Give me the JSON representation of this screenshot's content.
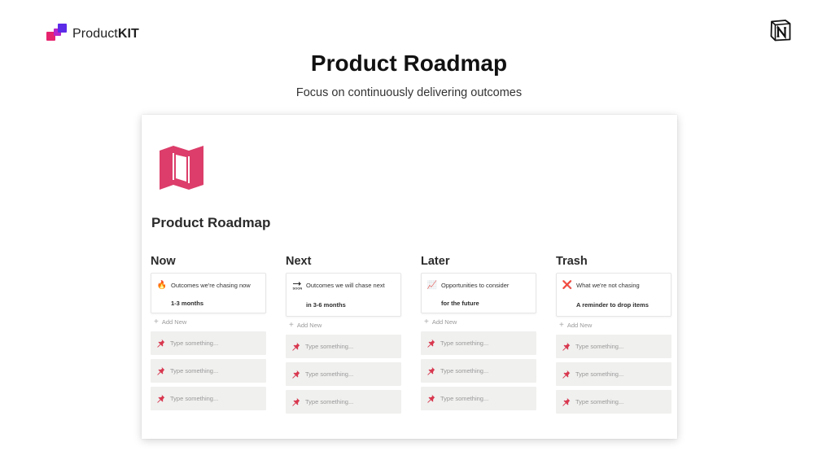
{
  "brand": {
    "name_plain": "Product",
    "name_bold": "KIT",
    "logo_icon": "productkit-logo-icon"
  },
  "header": {
    "title": "Product Roadmap",
    "subtitle": "Focus on continuously delivering outcomes",
    "notion_icon": "notion-logo-icon"
  },
  "board": {
    "page_icon": "map-icon",
    "title": "Product Roadmap",
    "accent_color": "#e0436b",
    "add_new_label": "Add New",
    "columns": [
      {
        "title": "Now",
        "cover_emoji": "🔥",
        "cover_icon": "fire-icon",
        "cover_text": "Outcomes we're chasing now",
        "cover_sub": "1-3 months",
        "items": [
          "Type something...",
          "Type something...",
          "Type something..."
        ]
      },
      {
        "title": "Next",
        "cover_emoji": "🔜",
        "cover_icon": "soon-arrow-icon",
        "cover_text": "Outcomes we will chase next",
        "cover_sub": "in 3-6 months",
        "items": [
          "Type something...",
          "Type something...",
          "Type something..."
        ]
      },
      {
        "title": "Later",
        "cover_emoji": "📈",
        "cover_icon": "chart-icon",
        "cover_text": "Opportunities to consider",
        "cover_sub": "for the future",
        "items": [
          "Type something...",
          "Type something...",
          "Type something..."
        ]
      },
      {
        "title": "Trash",
        "cover_emoji": "❌",
        "cover_icon": "cross-mark-icon",
        "cover_text": "What we're not chasing",
        "cover_sub": "A reminder to drop items",
        "items": [
          "Type something...",
          "Type something...",
          "Type something..."
        ]
      }
    ]
  }
}
